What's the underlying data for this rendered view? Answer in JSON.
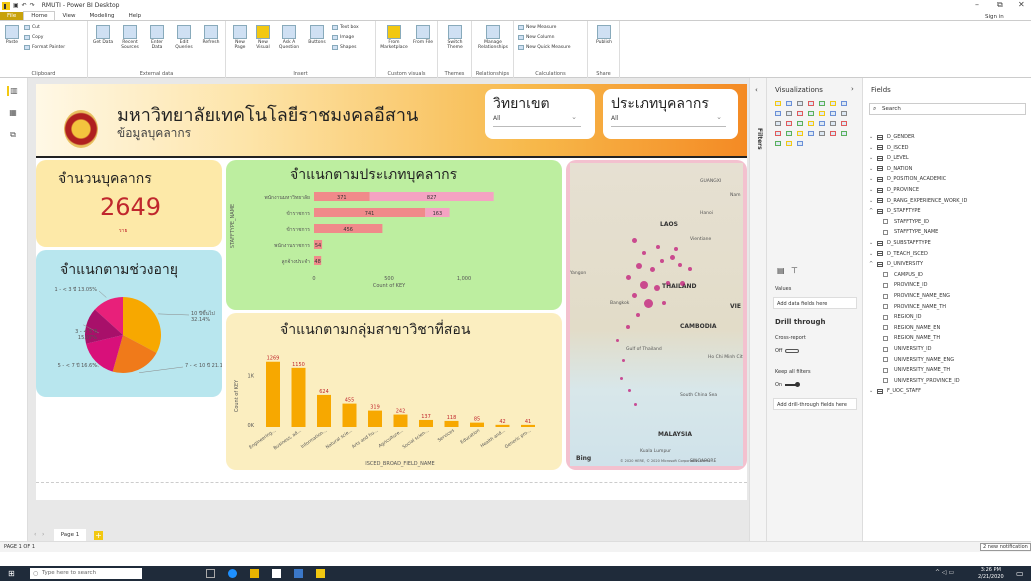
{
  "window": {
    "title": "RMUTI - Power BI Desktop",
    "minimize": "–",
    "restore": "⧉",
    "close": "✕",
    "sign_in": "Sign in"
  },
  "ribbon_tabs": [
    "File",
    "Home",
    "View",
    "Modeling",
    "Help"
  ],
  "ribbon": {
    "clipboard": {
      "paste": "Paste",
      "cut": "Cut",
      "copy": "Copy",
      "format_painter": "Format Painter",
      "label": "Clipboard"
    },
    "external": {
      "get_data": "Get Data",
      "recent_sources": "Recent Sources",
      "enter_data": "Enter Data",
      "edit_queries": "Edit Queries",
      "refresh": "Refresh",
      "label": "External data"
    },
    "insert": {
      "new_page": "New Page",
      "new_visual": "New Visual",
      "ask_question": "Ask A Question",
      "buttons": "Buttons",
      "text_box": "Text box",
      "image": "Image",
      "shapes": "Shapes",
      "label": "Insert"
    },
    "custom": {
      "marketplace": "From Marketplace",
      "file": "From File",
      "label": "Custom visuals"
    },
    "themes": {
      "switch": "Switch Theme",
      "label": "Themes"
    },
    "relationships": {
      "manage": "Manage Relationships",
      "label": "Relationships"
    },
    "calc": {
      "new_measure": "New Measure",
      "new_column": "New Column",
      "quick_measure": "New Quick Measure",
      "label": "Calculations"
    },
    "share": {
      "publish": "Publish",
      "label": "Share"
    }
  },
  "report": {
    "title": "มหาวิทยาลัยเทคโนโลยีราชมงคลอีสาน",
    "subtitle": "ข้อมูลบุคลากร",
    "slicer_campus": {
      "title": "วิทยาเขต",
      "value": "All"
    },
    "slicer_type": {
      "title": "ประเภทบุคลากร",
      "value": "All"
    },
    "count_card": {
      "title": "จำนวนบุคลากร",
      "value": "2649",
      "sub": "ราย"
    },
    "age_card": {
      "title": "จำแนกตามช่วงอายุ"
    },
    "type_card": {
      "title": "จำแนกตามประเภทบุคลากร",
      "axis_label": "STAFFTYPE_NAME",
      "x_label": "Count of KEY"
    },
    "field_card": {
      "title": "จำแนกตามกลุ่มสาขาวิชาที่สอน",
      "axis_label": "Count of KEY",
      "x_label": "ISCED_BROAD_FIELD_NAME"
    },
    "map": {
      "labels": [
        "LAOS",
        "THAILAND",
        "CAMBODIA",
        "VIE",
        "MALAYSIA",
        "GUANGXI",
        "Hanoi",
        "Vientiane",
        "Bangkok",
        "Gulf of Thailand",
        "Ho Chi Minh City",
        "South China Sea",
        "Kuala Lumpur",
        "SINGAPORE",
        "Yangon",
        "Nam"
      ],
      "bing": "Bing",
      "copyright": "© 2020 HERE, © 2020 Microsoft Corporation Terms"
    }
  },
  "chart_data": [
    {
      "type": "pie",
      "title": "จำแนกตามช่วงอายุ",
      "series": [
        {
          "name": "1 - < 3 ปี",
          "value": 13.05,
          "label": "1 - < 3 ปี 13.05%",
          "color": "#e8207a"
        },
        {
          "name": "10 ปีขึ้นไป",
          "value": 32.14,
          "label": "10 ปีขึ้นไป 32.14%",
          "color": "#f7a800"
        },
        {
          "name": "7 - < 10 ปี",
          "value": 21.14,
          "label": "7 - < 10 ปี 21.14%",
          "color": "#f07a1a"
        },
        {
          "name": "5 - < 7 ปี",
          "value": 16.6,
          "label": "5 - < 7 ปี 16.6%",
          "color": "#d8107a"
        },
        {
          "name": "3 - < 5 ปี",
          "value": 15.07,
          "label": "3 - < 5 ปี 15.07%",
          "color": "#a8106a"
        }
      ]
    },
    {
      "type": "bar",
      "orientation": "horizontal",
      "stacked": true,
      "title": "จำแนกตามประเภทบุคลากร",
      "ylabel": "STAFFTYPE_NAME",
      "xlabel": "Count of KEY",
      "categories": [
        "พนักงานมหาวิทยาลัย",
        "ข้าราชการ",
        "ข้าราชการ",
        "พนักงานราชการ",
        "ลูกจ้างประจำ"
      ],
      "series": [
        {
          "values": [
            371,
            741,
            456,
            54,
            48
          ],
          "color": "#f08a8a"
        },
        {
          "values": [
            827,
            163,
            0,
            0,
            0
          ],
          "color": "#f4a3c2"
        }
      ],
      "xticks": [
        "0",
        "500",
        "1,000"
      ],
      "xlim": [
        0,
        1300
      ]
    },
    {
      "type": "bar",
      "title": "จำแนกตามกลุ่มสาขาวิชาที่สอน",
      "xlabel": "ISCED_BROAD_FIELD_NAME",
      "ylabel": "Count of KEY",
      "categories": [
        "Engineering...",
        "Business, ad...",
        "Information...",
        "Natural scie...",
        "Arts and hu...",
        "Agriculture...",
        "Social scien...",
        "Services",
        "Education",
        "Health and...",
        "Generic pro..."
      ],
      "values": [
        1269,
        1150,
        624,
        455,
        319,
        242,
        137,
        118,
        85,
        42,
        41
      ],
      "yticks": [
        "0K",
        "1K"
      ],
      "ylim": [
        0,
        1400
      ],
      "color": "#f7a800"
    }
  ],
  "viz_pane": {
    "title": "Visualizations",
    "values": "Values",
    "add_data": "Add data fields here",
    "drill": "Drill through",
    "cross_report": "Cross-report",
    "off": "Off",
    "keep_filters": "Keep all filters",
    "on": "On",
    "add_drill": "Add drill-through fields here",
    "filters": "Filters"
  },
  "fields_pane": {
    "title": "Fields",
    "search": "Search",
    "items": [
      {
        "name": "D_GENDER",
        "kind": "table",
        "open": false
      },
      {
        "name": "D_ISCED",
        "kind": "table",
        "open": false
      },
      {
        "name": "D_LEVEL",
        "kind": "table",
        "open": false
      },
      {
        "name": "D_NATION",
        "kind": "table",
        "open": false
      },
      {
        "name": "D_POSITION_ACADEMIC",
        "kind": "table",
        "open": false
      },
      {
        "name": "D_PROVINCE",
        "kind": "table",
        "open": false
      },
      {
        "name": "D_RANG_EXPERIENCE_WORK_ID",
        "kind": "table",
        "open": false
      },
      {
        "name": "D_STAFFTYPE",
        "kind": "table",
        "open": true
      },
      {
        "name": "STAFFTYPE_ID",
        "kind": "field"
      },
      {
        "name": "STAFFTYPE_NAME",
        "kind": "field"
      },
      {
        "name": "D_SUBSTAFFTYPE",
        "kind": "table",
        "open": false
      },
      {
        "name": "D_TEACH_ISCED",
        "kind": "table",
        "open": false
      },
      {
        "name": "D_UNIVERSITY",
        "kind": "table",
        "open": true
      },
      {
        "name": "CAMPUS_ID",
        "kind": "field"
      },
      {
        "name": "PROVINCE_ID",
        "kind": "field"
      },
      {
        "name": "PROVINCE_NAME_ENG",
        "kind": "field"
      },
      {
        "name": "PROVINCE_NAME_TH",
        "kind": "field"
      },
      {
        "name": "REGION_ID",
        "kind": "field"
      },
      {
        "name": "REGION_NAME_EN",
        "kind": "field"
      },
      {
        "name": "REGION_NAME_TH",
        "kind": "field"
      },
      {
        "name": "UNIVERSITY_ID",
        "kind": "field"
      },
      {
        "name": "UNIVERSITY_NAME_ENG",
        "kind": "field"
      },
      {
        "name": "UNIVERSITY_NAME_TH",
        "kind": "field"
      },
      {
        "name": "UNIVERSITY_PROVINCE_ID",
        "kind": "field"
      },
      {
        "name": "F_UOC_STAFF",
        "kind": "table",
        "open": false
      }
    ]
  },
  "pages": {
    "tab": "Page 1",
    "add": "+"
  },
  "status": {
    "page": "PAGE 1 OF 1",
    "notification": "2 new notification"
  },
  "taskbar": {
    "search": "Type here to search",
    "time": "3:26 PM",
    "date": "2/21/2020"
  }
}
